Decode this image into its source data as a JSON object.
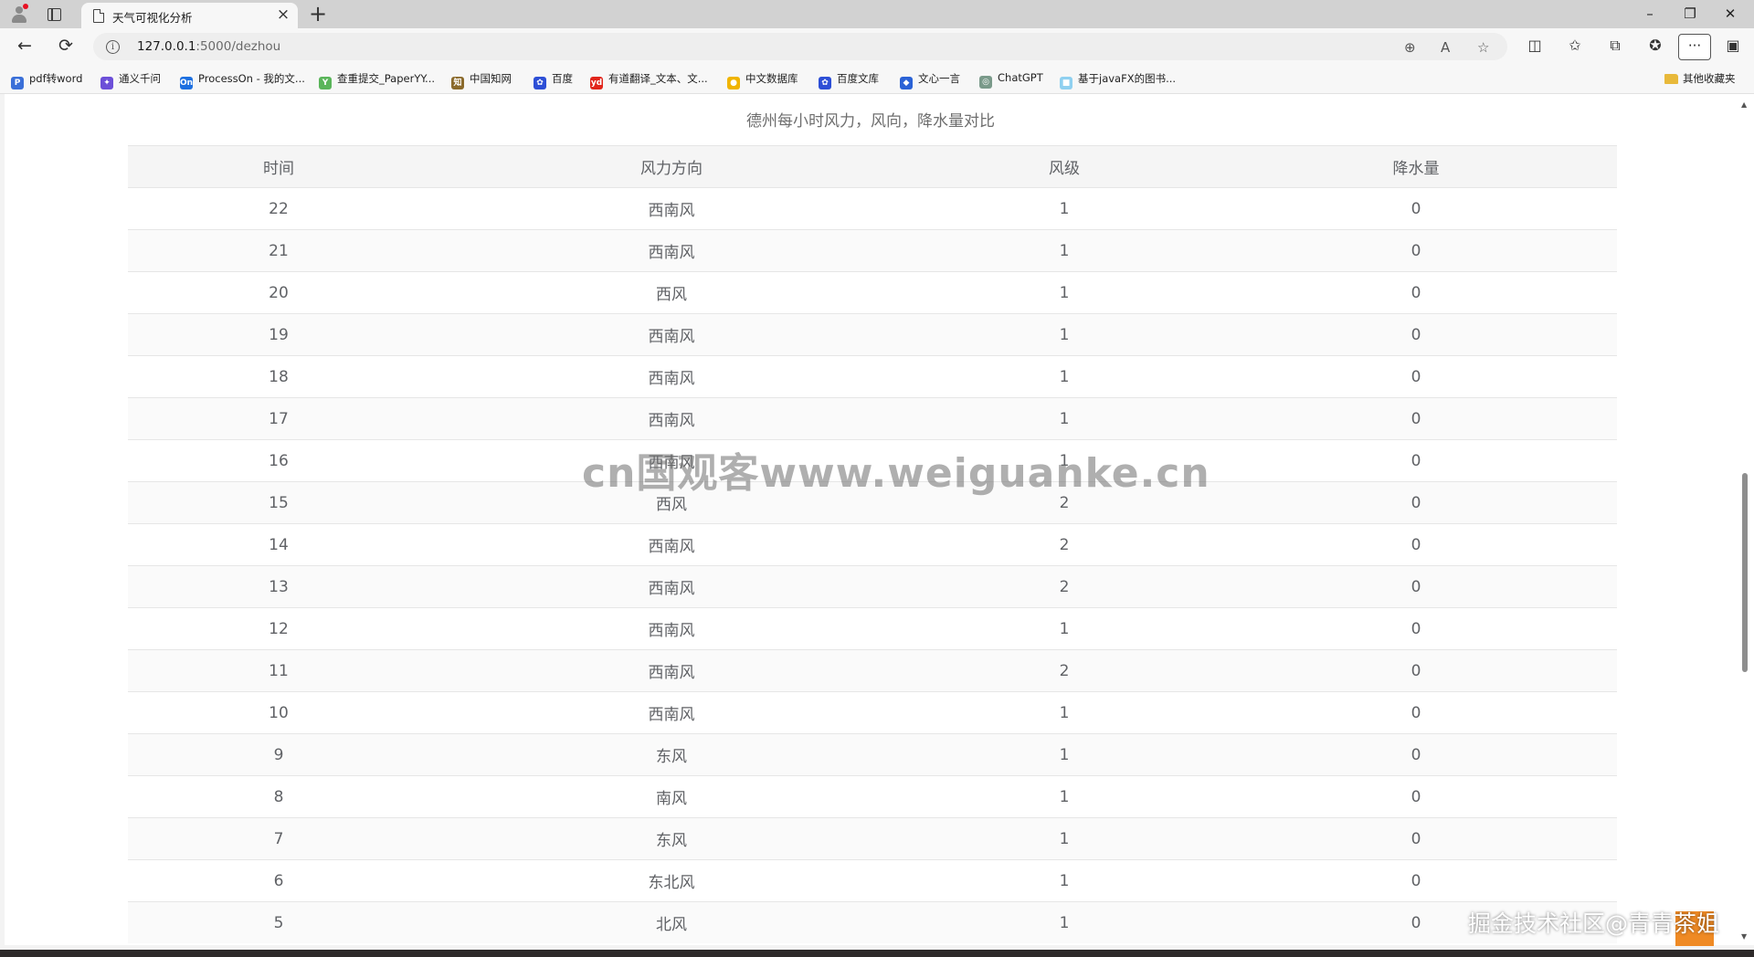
{
  "tab": {
    "title": "天气可视化分析",
    "close": "×",
    "new": "+"
  },
  "window": {
    "minimize": "–",
    "restore": "❐",
    "close": "✕"
  },
  "address": {
    "host": "127.0.0.1",
    "path": ":5000/dezhou",
    "info": "i"
  },
  "nav": {
    "back": "←",
    "refresh": "⟳"
  },
  "toolbar": {
    "zoom": "⊕",
    "read_aloud": "A",
    "favorite": "☆",
    "split": "◫",
    "favorites": "✩",
    "collections": "⧉",
    "extensions": "✪",
    "more": "···",
    "sidebar": "▣"
  },
  "bookmarks": [
    {
      "label": "pdf转word",
      "icon": "P",
      "color": "#3a6fd8"
    },
    {
      "label": "通义千问",
      "icon": "✦",
      "color": "#6c4fd8"
    },
    {
      "label": "ProcessOn - 我的文...",
      "icon": "On",
      "color": "#1d6fe0"
    },
    {
      "label": "查重提交_PaperYY...",
      "icon": "Y",
      "color": "#5ab55a"
    },
    {
      "label": "中国知网",
      "icon": "知",
      "color": "#8b6a2b"
    },
    {
      "label": "百度",
      "icon": "✿",
      "color": "#2d4fd6"
    },
    {
      "label": "有道翻译_文本、文...",
      "icon": "yd",
      "color": "#e1251b"
    },
    {
      "label": "中文数据库",
      "icon": "●",
      "color": "#f0b400"
    },
    {
      "label": "百度文库",
      "icon": "✿",
      "color": "#2d4fd6"
    },
    {
      "label": "文心一言",
      "icon": "◆",
      "color": "#2a62d6"
    },
    {
      "label": "ChatGPT",
      "icon": "◎",
      "color": "#7a9a8a"
    },
    {
      "label": "基于javaFX的图书...",
      "icon": "■",
      "color": "#8fd0f0"
    }
  ],
  "other_bookmarks": "其他收藏夹",
  "page": {
    "title": "德州每小时风力，风向，降水量对比",
    "headers": [
      "时间",
      "风力方向",
      "风级",
      "降水量"
    ],
    "rows": [
      [
        "22",
        "西南风",
        "1",
        "0"
      ],
      [
        "21",
        "西南风",
        "1",
        "0"
      ],
      [
        "20",
        "西风",
        "1",
        "0"
      ],
      [
        "19",
        "西南风",
        "1",
        "0"
      ],
      [
        "18",
        "西南风",
        "1",
        "0"
      ],
      [
        "17",
        "西南风",
        "1",
        "0"
      ],
      [
        "16",
        "西南风",
        "1",
        "0"
      ],
      [
        "15",
        "西风",
        "2",
        "0"
      ],
      [
        "14",
        "西南风",
        "2",
        "0"
      ],
      [
        "13",
        "西南风",
        "2",
        "0"
      ],
      [
        "12",
        "西南风",
        "1",
        "0"
      ],
      [
        "11",
        "西南风",
        "2",
        "0"
      ],
      [
        "10",
        "西南风",
        "1",
        "0"
      ],
      [
        "9",
        "东风",
        "1",
        "0"
      ],
      [
        "8",
        "南风",
        "1",
        "0"
      ],
      [
        "7",
        "东风",
        "1",
        "0"
      ],
      [
        "6",
        "东北风",
        "1",
        "0"
      ],
      [
        "5",
        "北风",
        "1",
        "0"
      ]
    ]
  },
  "watermarks": {
    "center": "cn国观客www.weiguanke.cn",
    "corner": "掘金技术社区@青青茶姐"
  },
  "scroll": {
    "up": "▲",
    "down": "▼",
    "position": 0.45
  }
}
